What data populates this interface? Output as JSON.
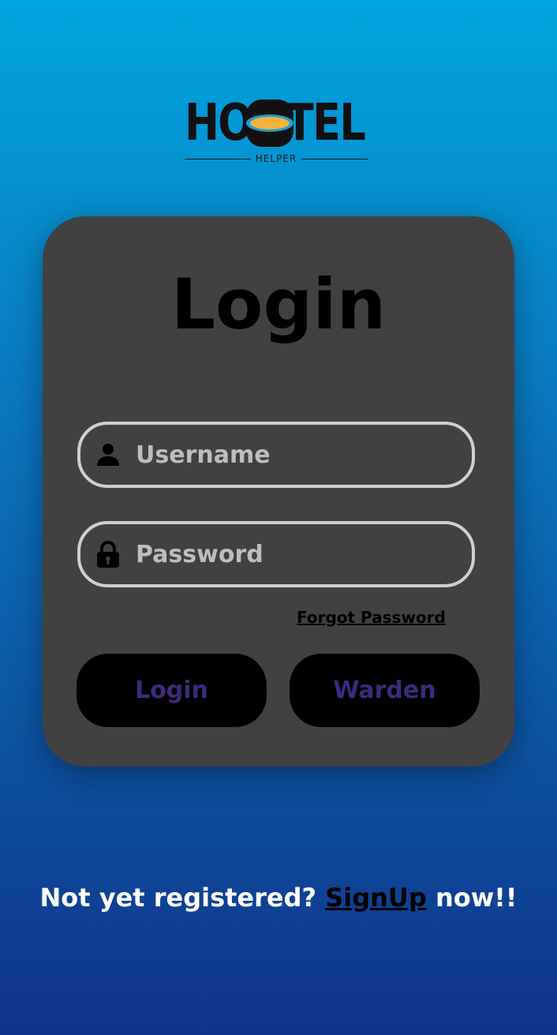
{
  "logo": {
    "word_left": "HO",
    "word_right": "TEL",
    "subtitle": "HELPER",
    "colors": {
      "ink": "#111111",
      "eye": "#f6b23d",
      "eye_rim": "#1aa1d6"
    }
  },
  "card": {
    "title": "Login",
    "username": {
      "placeholder": "Username",
      "value": "",
      "icon": "user-icon"
    },
    "password": {
      "placeholder": "Password",
      "value": "",
      "icon": "lock-icon"
    },
    "forgot_label": "Forgot Password",
    "buttons": {
      "login_label": "Login",
      "warden_label": "Warden"
    },
    "colors": {
      "card_bg": "#414141",
      "field_border": "#cfcfcf",
      "button_bg": "#000000",
      "button_text": "#3e2a7e"
    }
  },
  "footer": {
    "prefix": "Not yet registered? ",
    "link_label": "SignUp",
    "suffix": " now!!"
  }
}
